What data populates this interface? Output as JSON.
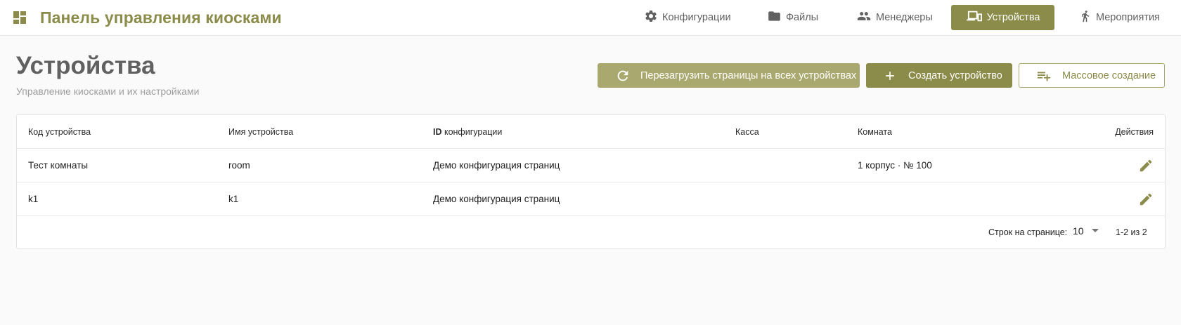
{
  "app": {
    "title": "Панель управления киосками"
  },
  "nav": {
    "items": [
      {
        "label": "Конфигурации",
        "icon": "gear-icon",
        "active": false
      },
      {
        "label": "Файлы",
        "icon": "folder-icon",
        "active": false
      },
      {
        "label": "Менеджеры",
        "icon": "people-icon",
        "active": false
      },
      {
        "label": "Устройства",
        "icon": "devices-icon",
        "active": true
      },
      {
        "label": "Мероприятия",
        "icon": "person-walking-icon",
        "active": false
      }
    ]
  },
  "page": {
    "title": "Устройства",
    "subtitle": "Управление киосками и их настройками"
  },
  "actions": {
    "reload_label": "Перезагрузить страницы на всех устройствах",
    "create_label": "Создать устройство",
    "bulk_label": "Массовое создание"
  },
  "table": {
    "headers": {
      "code": "Код устройства",
      "name": "Имя устройства",
      "config_id_prefix": "ID",
      "config_id_rest": " конфигурации",
      "cashbox": "Касса",
      "room": "Комната",
      "actions": "Действия"
    },
    "rows": [
      {
        "code": "Тест комнаты",
        "name": "room",
        "config": "Демо конфигурация страниц",
        "cashbox": "",
        "room": "1 корпус · № 100"
      },
      {
        "code": "k1",
        "name": "k1",
        "config": "Демо конфигурация страниц",
        "cashbox": "",
        "room": ""
      }
    ]
  },
  "pagination": {
    "rows_per_page_label": "Строк на странице:",
    "rows_per_page_value": "10",
    "range": "1-2 из 2"
  },
  "colors": {
    "accent": "#8b8b4a",
    "accent_light": "#a9a86e",
    "muted_text": "#616161"
  }
}
